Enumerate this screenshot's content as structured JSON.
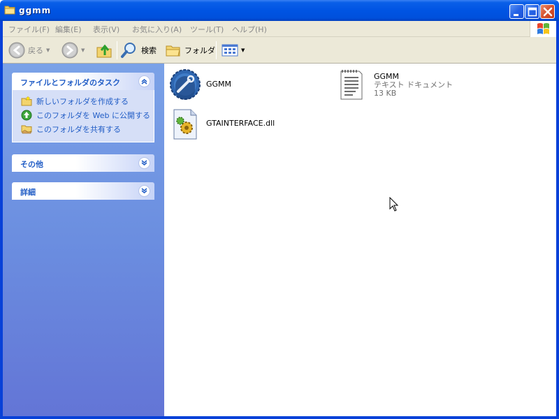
{
  "window": {
    "title": "ggmm",
    "controls": {
      "minimize": "minimize",
      "maximize": "maximize",
      "close": "close"
    }
  },
  "menu": {
    "items": [
      {
        "label": "ファイル(F)"
      },
      {
        "label": "編集(E)"
      },
      {
        "label": "表示(V)"
      },
      {
        "label": "お気に入り(A)"
      },
      {
        "label": "ツール(T)"
      },
      {
        "label": "ヘルプ(H)"
      }
    ]
  },
  "toolbar": {
    "back_label": "戻る",
    "search_label": "検索",
    "folders_label": "フォルダ"
  },
  "tasks": {
    "file_folder": {
      "title": "ファイルとフォルダのタスク",
      "items": [
        {
          "label": "新しいフォルダを作成する",
          "icon": "new-folder-icon"
        },
        {
          "label": "このフォルダを Web に公開する",
          "icon": "publish-web-icon"
        },
        {
          "label": "このフォルダを共有する",
          "icon": "share-folder-icon"
        }
      ]
    },
    "other": {
      "title": "その他"
    },
    "details": {
      "title": "詳細"
    }
  },
  "files": [
    {
      "name": "GGMM",
      "icon": "application-gear-icon"
    },
    {
      "name": "GGMM",
      "type": "テキスト ドキュメント",
      "size": "13 KB",
      "icon": "text-document-icon"
    },
    {
      "name": "GTAINTERFACE.dll",
      "icon": "dll-file-icon"
    }
  ],
  "colors": {
    "titlebar": "#0054e3",
    "taskpane": "#6b8ee0",
    "task_link": "#215dc6"
  }
}
